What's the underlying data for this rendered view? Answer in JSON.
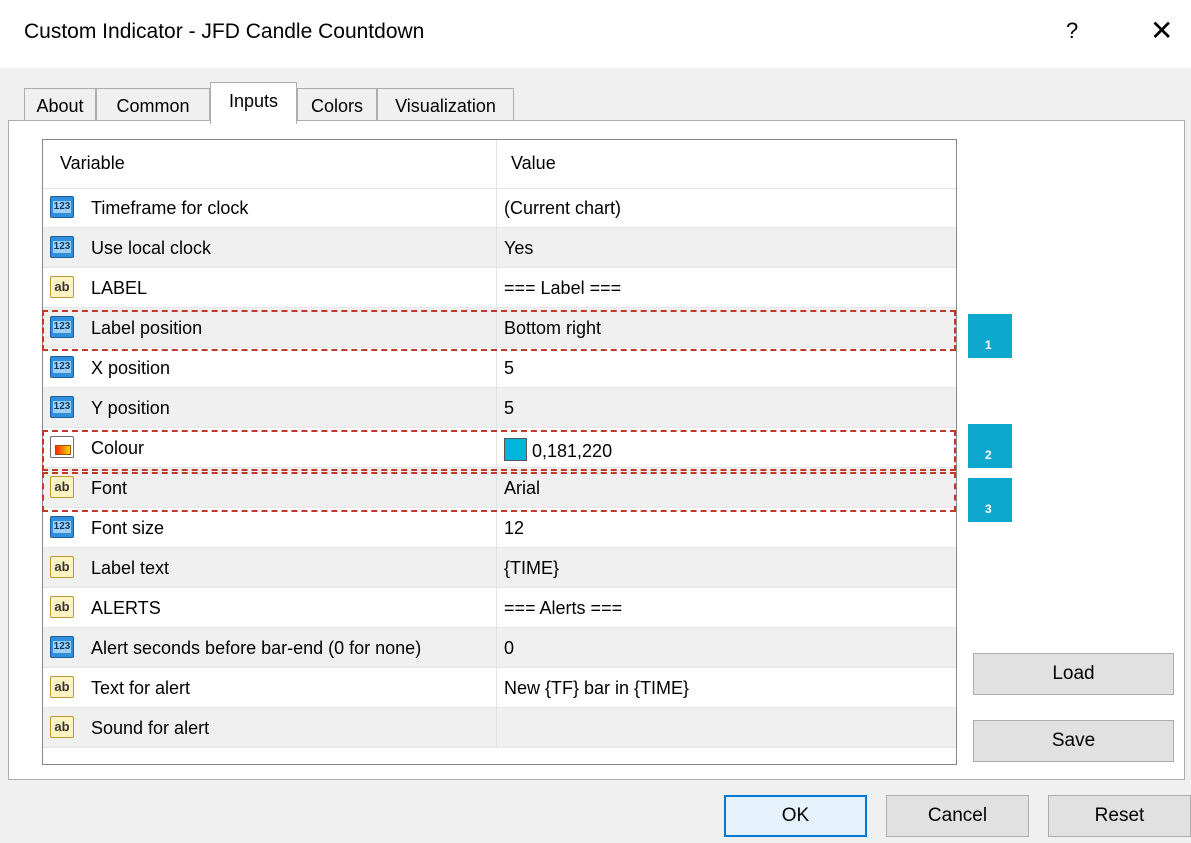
{
  "window": {
    "title": "Custom Indicator - JFD Candle Countdown",
    "help_label": "?",
    "close_label": "✕"
  },
  "tabs": [
    {
      "label": "About"
    },
    {
      "label": "Common"
    },
    {
      "label": "Inputs",
      "active": true
    },
    {
      "label": "Colors"
    },
    {
      "label": "Visualization"
    }
  ],
  "grid": {
    "headers": {
      "variable": "Variable",
      "value": "Value"
    },
    "rows": [
      {
        "type": "number",
        "name": "Timeframe for clock",
        "value": "(Current chart)"
      },
      {
        "type": "number",
        "name": "Use local clock",
        "value": "Yes"
      },
      {
        "type": "string",
        "name": "LABEL",
        "value": "=== Label ==="
      },
      {
        "type": "number",
        "name": "Label position",
        "value": "Bottom right"
      },
      {
        "type": "number",
        "name": "X position",
        "value": "5"
      },
      {
        "type": "number",
        "name": "Y position",
        "value": "5"
      },
      {
        "type": "color",
        "name": "Colour",
        "value": "0,181,220",
        "swatch": "#00b5dc"
      },
      {
        "type": "string",
        "name": "Font",
        "value": "Arial"
      },
      {
        "type": "number",
        "name": "Font size",
        "value": "12"
      },
      {
        "type": "string",
        "name": "Label text",
        "value": "{TIME}"
      },
      {
        "type": "string",
        "name": "ALERTS",
        "value": "=== Alerts ==="
      },
      {
        "type": "number",
        "name": "Alert seconds before bar-end (0 for none)",
        "value": "0"
      },
      {
        "type": "string",
        "name": "Text for alert",
        "value": "New {TF} bar in {TIME}"
      },
      {
        "type": "string",
        "name": "Sound for alert",
        "value": ""
      }
    ],
    "icon_labels": {
      "number": "123",
      "string": "ab"
    }
  },
  "callouts": [
    {
      "number": "1"
    },
    {
      "number": "2"
    },
    {
      "number": "3"
    }
  ],
  "buttons": {
    "load": "Load",
    "save": "Save",
    "ok": "OK",
    "cancel": "Cancel",
    "reset": "Reset"
  },
  "colors": {
    "callout_fill": "#0ea8cf",
    "callout_border": "#c0392b",
    "accent": "#0078d7"
  }
}
